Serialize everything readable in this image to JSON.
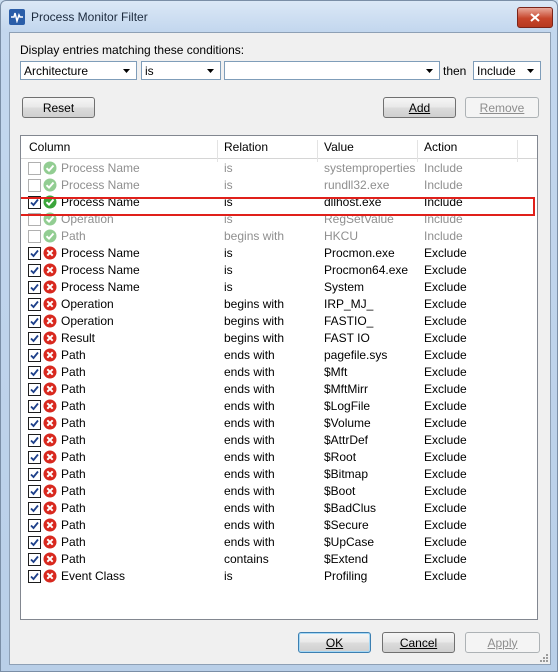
{
  "window": {
    "title": "Process Monitor Filter",
    "close_icon": "close-icon"
  },
  "filter": {
    "prompt": "Display entries matching these conditions:",
    "column_value": "Architecture",
    "relation_value": "is",
    "value_text": "",
    "then_label": "then",
    "action_value": "Include"
  },
  "buttons": {
    "reset": "Reset",
    "add": "Add",
    "remove": "Remove",
    "ok": "OK",
    "cancel": "Cancel",
    "apply": "Apply"
  },
  "list": {
    "headers": [
      "Column",
      "Relation",
      "Value",
      "Action"
    ],
    "rows": [
      {
        "checked": false,
        "enabled": false,
        "icon": "include",
        "column": "Process Name",
        "relation": "is",
        "value": "systemproperties...",
        "action": "Include"
      },
      {
        "checked": false,
        "enabled": false,
        "icon": "include",
        "column": "Process Name",
        "relation": "is",
        "value": "rundll32.exe",
        "action": "Include"
      },
      {
        "checked": true,
        "enabled": true,
        "icon": "include",
        "column": "Process Name",
        "relation": "is",
        "value": "dllhost.exe",
        "action": "Include"
      },
      {
        "checked": false,
        "enabled": false,
        "icon": "include",
        "column": "Operation",
        "relation": "is",
        "value": "RegSetValue",
        "action": "Include"
      },
      {
        "checked": false,
        "enabled": false,
        "icon": "include",
        "column": "Path",
        "relation": "begins with",
        "value": "HKCU",
        "action": "Include"
      },
      {
        "checked": true,
        "enabled": true,
        "icon": "exclude",
        "column": "Process Name",
        "relation": "is",
        "value": "Procmon.exe",
        "action": "Exclude"
      },
      {
        "checked": true,
        "enabled": true,
        "icon": "exclude",
        "column": "Process Name",
        "relation": "is",
        "value": "Procmon64.exe",
        "action": "Exclude"
      },
      {
        "checked": true,
        "enabled": true,
        "icon": "exclude",
        "column": "Process Name",
        "relation": "is",
        "value": "System",
        "action": "Exclude"
      },
      {
        "checked": true,
        "enabled": true,
        "icon": "exclude",
        "column": "Operation",
        "relation": "begins with",
        "value": "IRP_MJ_",
        "action": "Exclude"
      },
      {
        "checked": true,
        "enabled": true,
        "icon": "exclude",
        "column": "Operation",
        "relation": "begins with",
        "value": "FASTIO_",
        "action": "Exclude"
      },
      {
        "checked": true,
        "enabled": true,
        "icon": "exclude",
        "column": "Result",
        "relation": "begins with",
        "value": "FAST IO",
        "action": "Exclude"
      },
      {
        "checked": true,
        "enabled": true,
        "icon": "exclude",
        "column": "Path",
        "relation": "ends with",
        "value": "pagefile.sys",
        "action": "Exclude"
      },
      {
        "checked": true,
        "enabled": true,
        "icon": "exclude",
        "column": "Path",
        "relation": "ends with",
        "value": "$Mft",
        "action": "Exclude"
      },
      {
        "checked": true,
        "enabled": true,
        "icon": "exclude",
        "column": "Path",
        "relation": "ends with",
        "value": "$MftMirr",
        "action": "Exclude"
      },
      {
        "checked": true,
        "enabled": true,
        "icon": "exclude",
        "column": "Path",
        "relation": "ends with",
        "value": "$LogFile",
        "action": "Exclude"
      },
      {
        "checked": true,
        "enabled": true,
        "icon": "exclude",
        "column": "Path",
        "relation": "ends with",
        "value": "$Volume",
        "action": "Exclude"
      },
      {
        "checked": true,
        "enabled": true,
        "icon": "exclude",
        "column": "Path",
        "relation": "ends with",
        "value": "$AttrDef",
        "action": "Exclude"
      },
      {
        "checked": true,
        "enabled": true,
        "icon": "exclude",
        "column": "Path",
        "relation": "ends with",
        "value": "$Root",
        "action": "Exclude"
      },
      {
        "checked": true,
        "enabled": true,
        "icon": "exclude",
        "column": "Path",
        "relation": "ends with",
        "value": "$Bitmap",
        "action": "Exclude"
      },
      {
        "checked": true,
        "enabled": true,
        "icon": "exclude",
        "column": "Path",
        "relation": "ends with",
        "value": "$Boot",
        "action": "Exclude"
      },
      {
        "checked": true,
        "enabled": true,
        "icon": "exclude",
        "column": "Path",
        "relation": "ends with",
        "value": "$BadClus",
        "action": "Exclude"
      },
      {
        "checked": true,
        "enabled": true,
        "icon": "exclude",
        "column": "Path",
        "relation": "ends with",
        "value": "$Secure",
        "action": "Exclude"
      },
      {
        "checked": true,
        "enabled": true,
        "icon": "exclude",
        "column": "Path",
        "relation": "ends with",
        "value": "$UpCase",
        "action": "Exclude"
      },
      {
        "checked": true,
        "enabled": true,
        "icon": "exclude",
        "column": "Path",
        "relation": "contains",
        "value": "$Extend",
        "action": "Exclude"
      },
      {
        "checked": true,
        "enabled": true,
        "icon": "exclude",
        "column": "Event Class",
        "relation": "is",
        "value": "Profiling",
        "action": "Exclude"
      }
    ]
  },
  "colors": {
    "include": "#3aa53a",
    "exclude": "#d8281e",
    "highlight": "#e0201a",
    "disabled_text": "#8f8f8f"
  }
}
